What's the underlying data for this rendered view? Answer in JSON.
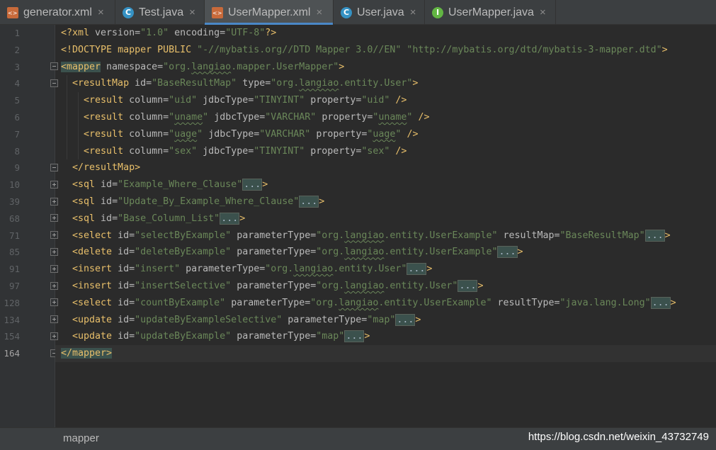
{
  "tabs": [
    {
      "label": "generator.xml",
      "icon": "xml-file-icon",
      "active": false
    },
    {
      "label": "Test.java",
      "icon": "java-class-icon",
      "active": false
    },
    {
      "label": "UserMapper.xml",
      "icon": "xml-file-icon",
      "active": true
    },
    {
      "label": "User.java",
      "icon": "java-class-icon",
      "active": false
    },
    {
      "label": "UserMapper.java",
      "icon": "java-interface-icon",
      "active": false
    }
  ],
  "close_glyph": "×",
  "line_numbers": [
    "1",
    "2",
    "3",
    "4",
    "5",
    "6",
    "7",
    "8",
    "9",
    "10",
    "39",
    "68",
    "71",
    "85",
    "91",
    "97",
    "128",
    "134",
    "154",
    "164"
  ],
  "current_line": "164",
  "fold_placeholder": "...",
  "code": {
    "l1": {
      "open": "<?xml",
      "a1": " version=",
      "v1": "\"1.0\"",
      "a2": " encoding=",
      "v2": "\"UTF-8\"",
      "close": "?>"
    },
    "l2": {
      "open": "<!DOCTYPE",
      "text": " mapper PUBLIC ",
      "v1": "\"-//mybatis.org//DTD Mapper 3.0//EN\"",
      "sp": " ",
      "v2": "\"http://mybatis.org/dtd/mybatis-3-mapper.dtd\"",
      "close": ">"
    },
    "l3": {
      "open": "<mapper",
      "a1": " namespace=",
      "v1a": "\"org.",
      "v1u": "langiao",
      "v1b": ".mapper.UserMapper\"",
      "close": ">"
    },
    "l4": {
      "open": "<resultMap",
      "a1": " id=",
      "v1": "\"BaseResultMap\"",
      "a2": " type=",
      "v2a": "\"org.",
      "v2u": "langiao",
      "v2b": ".entity.User\"",
      "close": ">"
    },
    "l5": {
      "open": "<result",
      "a1": " column=",
      "v1": "\"uid\"",
      "a2": " jdbcType=",
      "v2": "\"TINYINT\"",
      "a3": " property=",
      "v3": "\"uid\"",
      "close": " />"
    },
    "l6": {
      "open": "<result",
      "a1": " column=",
      "v1a": "\"",
      "v1u": "uname",
      "v1b": "\"",
      "a2": " jdbcType=",
      "v2": "\"VARCHAR\"",
      "a3": " property=",
      "v3a": "\"",
      "v3u": "uname",
      "v3b": "\"",
      "close": " />"
    },
    "l7": {
      "open": "<result",
      "a1": " column=",
      "v1a": "\"",
      "v1u": "uage",
      "v1b": "\"",
      "a2": " jdbcType=",
      "v2": "\"VARCHAR\"",
      "a3": " property=",
      "v3a": "\"",
      "v3u": "uage",
      "v3b": "\"",
      "close": " />"
    },
    "l8": {
      "open": "<result",
      "a1": " column=",
      "v1": "\"sex\"",
      "a2": " jdbcType=",
      "v2": "\"TINYINT\"",
      "a3": " property=",
      "v3": "\"sex\"",
      "close": " />"
    },
    "l9": {
      "close": "</resultMap>"
    },
    "l10": {
      "open": "<sql",
      "a1": " id=",
      "v1": "\"Example_Where_Clause\"",
      "close": ">"
    },
    "l39": {
      "open": "<sql",
      "a1": " id=",
      "v1": "\"Update_By_Example_Where_Clause\"",
      "close": ">"
    },
    "l68": {
      "open": "<sql",
      "a1": " id=",
      "v1": "\"Base_Column_List\"",
      "close": ">"
    },
    "l71": {
      "open": "<select",
      "a1": " id=",
      "v1": "\"selectByExample\"",
      "a2": " parameterType=",
      "v2a": "\"org.",
      "v2u": "langiao",
      "v2b": ".entity.UserExample\"",
      "a3": " resultMap=",
      "v3": "\"BaseResultMap\"",
      "close": ">"
    },
    "l85": {
      "open": "<delete",
      "a1": " id=",
      "v1": "\"deleteByExample\"",
      "a2": " parameterType=",
      "v2a": "\"org.",
      "v2u": "langiao",
      "v2b": ".entity.UserExample\"",
      "close": ">"
    },
    "l91": {
      "open": "<insert",
      "a1": " id=",
      "v1": "\"insert\"",
      "a2": " parameterType=",
      "v2a": "\"org.",
      "v2u": "langiao",
      "v2b": ".entity.User\"",
      "close": ">"
    },
    "l97": {
      "open": "<insert",
      "a1": " id=",
      "v1": "\"insertSelective\"",
      "a2": " parameterType=",
      "v2a": "\"org.",
      "v2u": "langiao",
      "v2b": ".entity.User\"",
      "close": ">"
    },
    "l128": {
      "open": "<select",
      "a1": " id=",
      "v1": "\"countByExample\"",
      "a2": " parameterType=",
      "v2a": "\"org.",
      "v2u": "langiao",
      "v2b": ".entity.UserExample\"",
      "a3": " resultType=",
      "v3": "\"java.lang.Long\"",
      "close": ">"
    },
    "l134": {
      "open": "<update",
      "a1": " id=",
      "v1": "\"updateByExampleSelective\"",
      "a2": " parameterType=",
      "v2": "\"map\"",
      "close": ">"
    },
    "l154": {
      "open": "<update",
      "a1": " id=",
      "v1": "\"updateByExample\"",
      "a2": " parameterType=",
      "v2": "\"map\"",
      "close": ">"
    },
    "l164": {
      "open": "</mapper",
      "close": ">"
    }
  },
  "status": {
    "breadcrumb": "mapper",
    "watermark": "https://blog.csdn.net/weixin_43732749"
  },
  "colors": {
    "background": "#2b2b2b",
    "tag": "#e8bf6a",
    "attribute": "#bababa",
    "value": "#6a8759",
    "active_tab_underline": "#4a88c7"
  }
}
